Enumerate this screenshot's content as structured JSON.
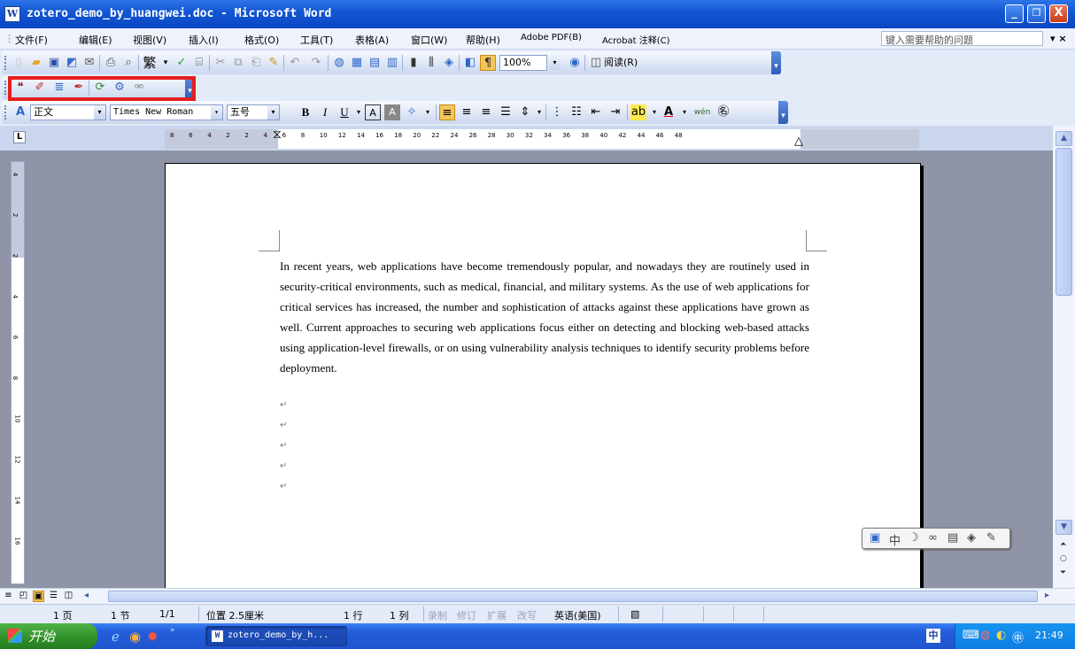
{
  "window": {
    "title": "zotero_demo_by_huangwei.doc - Microsoft Word",
    "buttons": {
      "minimize": "_",
      "maximize": "❐",
      "close": "X"
    }
  },
  "menu": {
    "items": [
      "文件(F)",
      "编辑(E)",
      "视图(V)",
      "插入(I)",
      "格式(O)",
      "工具(T)",
      "表格(A)",
      "窗口(W)",
      "帮助(H)",
      "Adobe PDF(B)",
      "Acrobat 注释(C)"
    ],
    "help_placeholder": "键入需要帮助的问题",
    "close": "▾ ×"
  },
  "standard_toolbar": {
    "traditional_label": "繁",
    "zoom": "100%",
    "read_label": "阅读(R)"
  },
  "formatting_toolbar": {
    "style": "正文",
    "font": "Times New Roman",
    "size": "五号",
    "bold": "B",
    "italic": "I",
    "underline": "U",
    "phonetic": "wén"
  },
  "ruler": {
    "ticks": [
      "8",
      "6",
      "4",
      "2",
      "2",
      "4",
      "6",
      "8",
      "10",
      "12",
      "14",
      "16",
      "18",
      "20",
      "22",
      "24",
      "26",
      "28",
      "30",
      "32",
      "34",
      "36",
      "38",
      "40",
      "42",
      "44",
      "46",
      "48"
    ],
    "vticks": [
      "4",
      "2",
      "2",
      "4",
      "6",
      "8",
      "10",
      "12",
      "14",
      "16"
    ]
  },
  "document": {
    "paragraph": "In recent years, web applications have become tremendously popular, and nowadays they are routinely used in security-critical environments, such as medical, financial, and military systems. As the use of web applications for critical services has increased, the number and sophistication of attacks against these applications have grown as well. Current approaches to securing web applications focus either on detecting and blocking web-based attacks using application-level firewalls, or on using vulnerability analysis techniques to identify security problems before deployment.",
    "empty_paragraph_marks": [
      "↵",
      "↵",
      "↵",
      "↵",
      "↵"
    ]
  },
  "status_bar": {
    "page": "1 页",
    "section": "1 节",
    "page_of": "1/1",
    "position": "位置 2.5厘米",
    "line": "1 行",
    "column": "1 列",
    "rec": "录制",
    "trk": "修订",
    "ext": "扩展",
    "ovr": "改写",
    "language": "英语(美国)"
  },
  "taskbar": {
    "start": "开始",
    "task": "zotero_demo_by_h...",
    "clock": "21:49"
  },
  "colors": {
    "title_bar": "#1457d4",
    "highlight_box": "#e61e1e",
    "taskbar": "#245edb",
    "start": "#2f8f2a"
  }
}
